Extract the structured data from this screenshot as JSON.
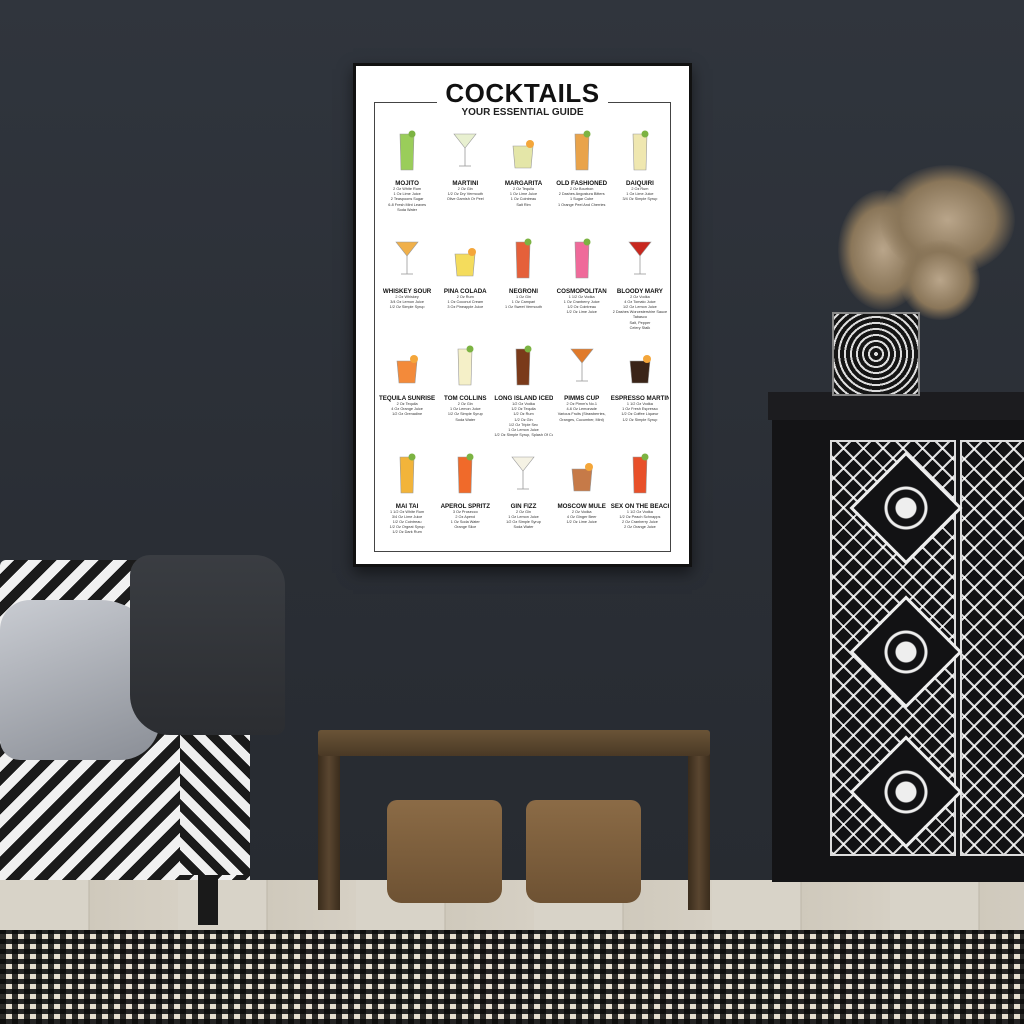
{
  "poster": {
    "title": "COCKTAILS",
    "subtitle": "YOUR ESSENTIAL GUIDE",
    "cocktails": [
      {
        "name": "MOJITO",
        "color": "#9acd5a",
        "lines": [
          "2 Oz White Rum",
          "1 Oz Lime Juice",
          "2 Teaspoons Sugar",
          "6-8 Fresh Mint Leaves",
          "Soda Water"
        ]
      },
      {
        "name": "MARTINI",
        "color": "#e8f0d0",
        "lines": [
          "2 Oz Gin",
          "1/2 Oz Dry Vermouth",
          "Olive Garnish Or Peel"
        ]
      },
      {
        "name": "MARGARITA",
        "color": "#e4e6a8",
        "lines": [
          "2 Oz Tequila",
          "1 Oz Lime Juice",
          "1 Oz Cointreau",
          "Salt Rim"
        ]
      },
      {
        "name": "OLD FASHIONED",
        "color": "#e9a34a",
        "lines": [
          "2 Oz Bourbon",
          "2 Dashes Angostura Bitters",
          "1 Sugar Cube",
          "1 Orange Peel And Cherries"
        ]
      },
      {
        "name": "DAIQUIRI",
        "color": "#efe7b0",
        "lines": [
          "2 Oz Rum",
          "1 Oz Lime Juice",
          "3/4 Oz Simple Syrup"
        ]
      },
      {
        "name": "WHISKEY SOUR",
        "color": "#f0b04a",
        "lines": [
          "2 Oz Whiskey",
          "3/4 Oz Lemon Juice",
          "1/2 Oz Simple Syrup"
        ]
      },
      {
        "name": "PINA COLADA",
        "color": "#f4dc5c",
        "lines": [
          "2 Oz Rum",
          "1 Oz Coconut Cream",
          "3 Oz Pineapple Juice"
        ]
      },
      {
        "name": "NEGRONI",
        "color": "#e5603a",
        "lines": [
          "1 Oz Gin",
          "1 Oz Campari",
          "1 Oz Sweet Vermouth"
        ]
      },
      {
        "name": "COSMOPOLITAN",
        "color": "#ef6a9a",
        "lines": [
          "1 1/2 Oz Vodka",
          "1 Oz Cranberry Juice",
          "1/2 Oz Cointreau",
          "1/2 Oz Lime Juice"
        ]
      },
      {
        "name": "BLOODY MARY",
        "color": "#c8281f",
        "lines": [
          "2 Oz Vodka",
          "4 Oz Tomato Juice",
          "1/2 Oz Lemon Juice",
          "2 Dashes Worcestershire Sauce",
          "Tabasco",
          "Salt, Pepper",
          "Celery Stalk"
        ]
      },
      {
        "name": "TEQUILA SUNRISE",
        "color": "#f38a3a",
        "lines": [
          "2 Oz Tequila",
          "4 Oz Orange Juice",
          "1/2 Oz Grenadine"
        ]
      },
      {
        "name": "TOM COLLINS",
        "color": "#f5f0c8",
        "lines": [
          "2 Oz Gin",
          "1 Oz Lemon Juice",
          "1/2 Oz Simple Syrup",
          "Soda Water"
        ]
      },
      {
        "name": "LONG ISLAND ICED TEA",
        "color": "#7a3a1a",
        "lines": [
          "1/2 Oz Vodka",
          "1/2 Oz Tequila",
          "1/2 Oz Rum",
          "1/2 Oz Gin",
          "1/2 Oz Triple Sec",
          "1 Oz Lemon Juice",
          "1/2 Oz Simple Syrup, Splash Of Cola"
        ]
      },
      {
        "name": "PIMMS CUP",
        "color": "#e07a2a",
        "lines": [
          "2 Oz Pimm's No.1",
          "4-6 Oz Lemonade",
          "Various Fruits (Strawberries,",
          "Oranges, Cucumber, Mint)"
        ]
      },
      {
        "name": "ESPRESSO MARTINI",
        "color": "#3a2418",
        "lines": [
          "1 1/2 Oz Vodka",
          "1 Oz Fresh Espresso",
          "1/2 Oz Coffee Liqueur",
          "1/2 Oz Simple Syrup"
        ]
      },
      {
        "name": "MAI TAI",
        "color": "#f2b43a",
        "lines": [
          "1 1/2 Oz White Rum",
          "3/4 Oz Lime Juice",
          "1/2 Oz Cointreau",
          "1/2 Oz Orgeat Syrup",
          "1/2 Oz Dark Rum"
        ]
      },
      {
        "name": "APEROL SPRITZ",
        "color": "#f06a2a",
        "lines": [
          "3 Oz Prosecco",
          "2 Oz Aperol",
          "1 Oz Soda Water",
          "Orange Slice"
        ]
      },
      {
        "name": "GIN FIZZ",
        "color": "#f5f2e4",
        "lines": [
          "2 Oz Gin",
          "1 Oz Lemon Juice",
          "1/2 Oz Simple Syrup",
          "Soda Water"
        ]
      },
      {
        "name": "MOSCOW MULE",
        "color": "#c67a48",
        "lines": [
          "2 Oz Vodka",
          "4 Oz Ginger Beer",
          "1/2 Oz Lime Juice"
        ]
      },
      {
        "name": "SEX ON THE BEACH",
        "color": "#e8502a",
        "lines": [
          "1 1/2 Oz Vodka",
          "1/2 Oz Peach Schnapps",
          "2 Oz Cranberry Juice",
          "2 Oz Orange Juice"
        ]
      }
    ]
  }
}
